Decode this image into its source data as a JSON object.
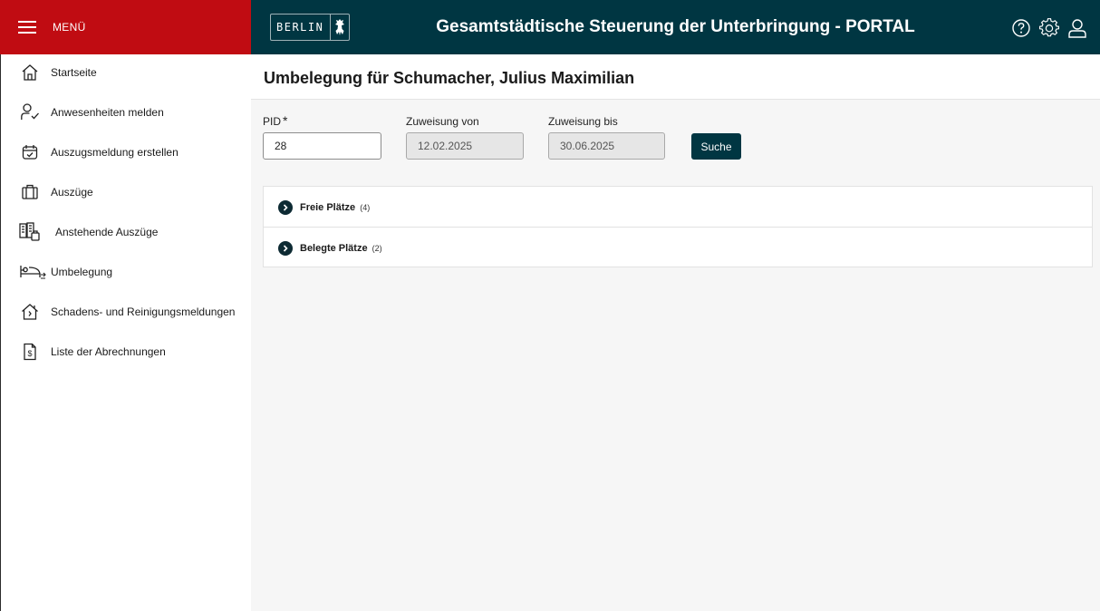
{
  "menu": {
    "label": "MENÜ"
  },
  "header": {
    "logo_text": "BERLIN",
    "title": "Gesamtstädtische Steuerung der Unterbringung - PORTAL",
    "icons": [
      "help-icon",
      "gear-icon",
      "user-icon"
    ]
  },
  "sidebar": {
    "items": [
      {
        "label": "Startseite",
        "icon": "home-icon"
      },
      {
        "label": "Anwesenheiten melden",
        "icon": "user-check-icon"
      },
      {
        "label": "Auszugsmeldung erstellen",
        "icon": "calendar-check-icon"
      },
      {
        "label": "Auszüge",
        "icon": "briefcase-icon"
      },
      {
        "label": "Anstehende Auszüge",
        "icon": "buildings-icon"
      },
      {
        "label": "Umbelegung",
        "icon": "bed-icon"
      },
      {
        "label": "Schadens- und Reinigungsmeldungen",
        "icon": "house-alert-icon"
      },
      {
        "label": "Liste der Abrechnungen",
        "icon": "invoice-icon"
      }
    ]
  },
  "main": {
    "page_title": "Umbelegung für Schumacher, Julius Maximilian",
    "form": {
      "pid_label": "PID",
      "pid_required_mark": "*",
      "pid_value": "28",
      "von_label": "Zuweisung von",
      "von_value": "12.02.2025",
      "bis_label": "Zuweisung bis",
      "bis_value": "30.06.2025",
      "search_label": "Suche"
    },
    "accordion": [
      {
        "title": "Freie Plätze",
        "count": "(4)"
      },
      {
        "title": "Belegte Plätze",
        "count": "(2)"
      }
    ]
  },
  "colors": {
    "menu_red": "#c00c12",
    "header_teal": "#003642",
    "content_bg": "#f6f6f6"
  }
}
